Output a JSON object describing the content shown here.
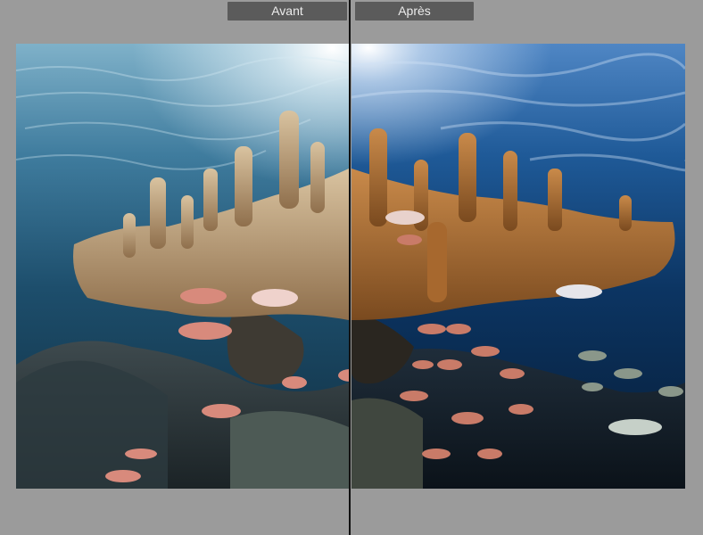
{
  "compare_view": {
    "before_label": "Avant",
    "after_label": "Après"
  },
  "colors": {
    "chrome_background": "#9b9b9b",
    "label_background": "#5b5b5b",
    "label_text": "#ececec",
    "divider": "#111111"
  }
}
